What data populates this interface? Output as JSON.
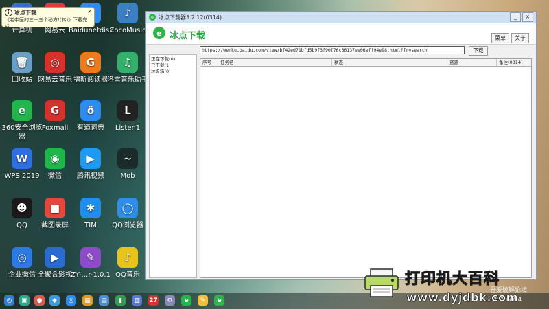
{
  "notification": {
    "title": "冰点下载",
    "message": "《老中医的三十五个秘方!(转)》下载完成",
    "info_icon": "info-icon",
    "close_icon": "close-icon"
  },
  "desktop": {
    "icons": [
      {
        "name": "desk-icon-top1",
        "label": "计算机",
        "glyph": "",
        "color": "#3a6bd0"
      },
      {
        "name": "desk-icon-top2",
        "label": "网易云",
        "glyph": "",
        "color": "#e53935"
      },
      {
        "name": "desk-icon-baidunetdisk",
        "label": "Baidunetdisk",
        "glyph": "",
        "color": "#2d8cf0"
      },
      {
        "name": "desk-icon-coco",
        "label": "CocoMusic",
        "glyph": "♪",
        "color": "#3b7fc4"
      },
      {
        "name": "desk-icon-recycle",
        "label": "回收站",
        "glyph": "🗑",
        "color": "#6aa0c8"
      },
      {
        "name": "desk-icon-netease-music",
        "label": "网易云音乐",
        "glyph": "◎",
        "color": "#d9302c"
      },
      {
        "name": "desk-icon-foxit",
        "label": "福昕阅读器",
        "glyph": "G",
        "color": "#f07a1a"
      },
      {
        "name": "desk-icon-luoxue",
        "label": "洛雪音乐助手",
        "glyph": "♫",
        "color": "#35b06a"
      },
      {
        "name": "desk-icon-360",
        "label": "360安全浏览器",
        "glyph": "e",
        "color": "#25b44c"
      },
      {
        "name": "desk-icon-foxmail",
        "label": "Foxmail",
        "glyph": "G",
        "color": "#d5322e"
      },
      {
        "name": "desk-icon-youdao",
        "label": "有道词典",
        "glyph": "ö",
        "color": "#2d8cf0"
      },
      {
        "name": "desk-icon-listen1",
        "label": "Listen1",
        "glyph": "L",
        "color": "#222222"
      },
      {
        "name": "desk-icon-wps",
        "label": "WPS 2019",
        "glyph": "W",
        "color": "#2f6fe0"
      },
      {
        "name": "desk-icon-wechat",
        "label": "微信",
        "glyph": "◉",
        "color": "#1fb64a"
      },
      {
        "name": "desk-icon-tencent-video",
        "label": "腾讯视频",
        "glyph": "▶",
        "color": "#1e9bf0"
      },
      {
        "name": "desk-icon-mob",
        "label": "Mob",
        "glyph": "~",
        "color": "#1b2a2a"
      },
      {
        "name": "desk-icon-qq",
        "label": "QQ",
        "glyph": "☻",
        "color": "#1a1a1a"
      },
      {
        "name": "desk-icon-jietu",
        "label": "截图录屏",
        "glyph": "■",
        "color": "#e5473f"
      },
      {
        "name": "desk-icon-tim",
        "label": "TIM",
        "glyph": "✱",
        "color": "#1e8ef0"
      },
      {
        "name": "desk-icon-qqbrowser",
        "label": "QQ浏览器",
        "glyph": "◯",
        "color": "#2f8fe8"
      },
      {
        "name": "desk-icon-qywx",
        "label": "企业微信",
        "glyph": "◎",
        "color": "#2c7be5"
      },
      {
        "name": "desk-icon-quanjuhe",
        "label": "全聚合影视",
        "glyph": "▶",
        "color": "#2a6bd0"
      },
      {
        "name": "desk-icon-zy",
        "label": "ZY-…r-1.0.1",
        "glyph": "✎",
        "color": "#8e4ac9"
      },
      {
        "name": "desk-icon-qqmusic",
        "label": "QQ音乐",
        "glyph": "♪",
        "color": "#e8c31c"
      }
    ]
  },
  "window": {
    "title": "冰点下载器3.2.12(0314)",
    "minimize": "_",
    "close": "×",
    "brand_logo": "e",
    "brand_name": "冰点下载",
    "menu_btn": "菜单",
    "about_btn": "关于",
    "sidebar": [
      "正在下载(0)",
      "已下载(1)",
      "垃圾箱(0)"
    ],
    "url_value": "https://wenku.baidu.com/view/bf42ed71bfd5b9f3f90f76c66137ee06eff94e98.html?fr=search",
    "download_btn": "下载",
    "columns": [
      "序号",
      "任务名",
      "状态",
      "资源",
      "备注(0314)"
    ]
  },
  "taskbar": {
    "clock": "2020/4/24"
  },
  "watermark": {
    "line1": "打印机大百科",
    "line2": "吾爱破解论坛",
    "line3": "www.dyjdbk.com",
    "printer_icon": "printer-icon"
  }
}
